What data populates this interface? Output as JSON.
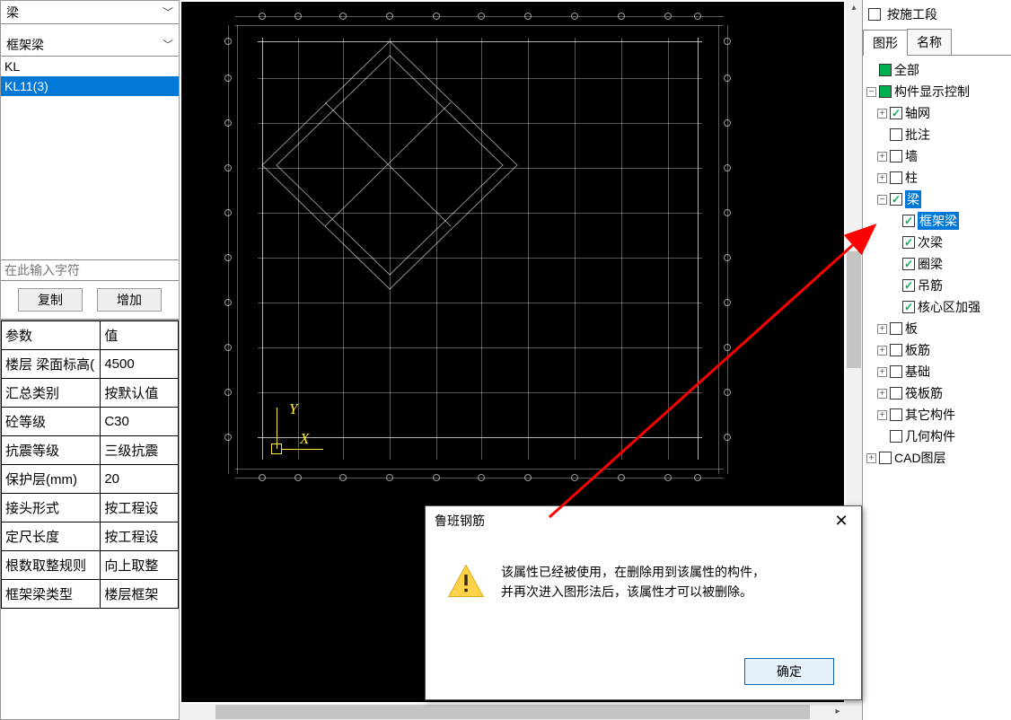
{
  "left": {
    "combo1": "梁",
    "combo2": "框架梁",
    "list": [
      "KL",
      "KL11(3)"
    ],
    "selected_index": 1,
    "filter_placeholder": "在此输入字符",
    "btn_copy": "复制",
    "btn_add": "增加",
    "props_header_param": "参数",
    "props_header_value": "值",
    "props": [
      {
        "k": "楼层 梁面标高(",
        "v": "4500"
      },
      {
        "k": "汇总类别",
        "v": "按默认值"
      },
      {
        "k": "砼等级",
        "v": "C30"
      },
      {
        "k": "抗震等级",
        "v": "三级抗震"
      },
      {
        "k": "保护层(mm)",
        "v": "20"
      },
      {
        "k": "接头形式",
        "v": "按工程设"
      },
      {
        "k": "定尺长度",
        "v": "按工程设"
      },
      {
        "k": "根数取整规则",
        "v": "向上取整"
      },
      {
        "k": "框架梁类型",
        "v": "楼层框架"
      }
    ]
  },
  "canvas": {
    "axis_x_label": "X",
    "axis_y_label": "Y"
  },
  "dialog": {
    "title": "鲁班钢筋",
    "line1": "该属性已经被使用，在删除用到该属性的构件，",
    "line2": "并再次进入图形法后，该属性才可以被删除。",
    "ok": "确定"
  },
  "right": {
    "stage_label": "按施工段",
    "tab_graphics": "图形",
    "tab_name": "名称",
    "tree": {
      "all": "全部",
      "component_ctrl": "构件显示控制",
      "axis": "轴网",
      "annot": "批注",
      "wall": "墙",
      "column": "柱",
      "beam": "梁",
      "frame_beam": "框架梁",
      "secondary_beam": "次梁",
      "ring_beam": "圈梁",
      "diaojin": "吊筋",
      "core_strength": "核心区加强",
      "slab": "板",
      "slab_rebar": "板筋",
      "foundation": "基础",
      "raft_rebar": "筏板筋",
      "other": "其它构件",
      "geom": "几何构件",
      "cad_layer": "CAD图层"
    }
  }
}
